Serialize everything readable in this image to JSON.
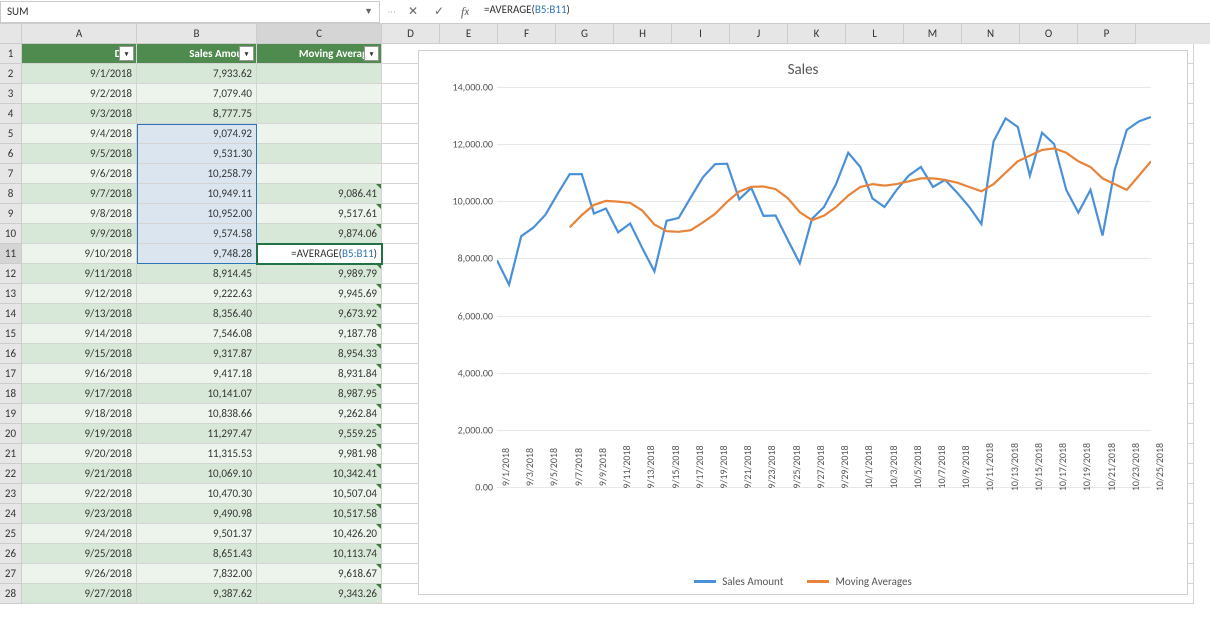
{
  "nameBox": "SUM",
  "formula": {
    "prefix": "=AVERAGE(",
    "ref": "B5:B11",
    "suffix": ")"
  },
  "columns": [
    "A",
    "B",
    "C",
    "D",
    "E",
    "F",
    "G",
    "H",
    "I",
    "J",
    "K",
    "L",
    "M",
    "N",
    "O",
    "P"
  ],
  "headers": {
    "a": "Day",
    "b": "Sales Amount",
    "c": "Moving Averages"
  },
  "rows": [
    {
      "n": 1
    },
    {
      "n": 2,
      "a": "9/1/2018",
      "b": "7,933.62",
      "c": ""
    },
    {
      "n": 3,
      "a": "9/2/2018",
      "b": "7,079.40",
      "c": ""
    },
    {
      "n": 4,
      "a": "9/3/2018",
      "b": "8,777.75",
      "c": ""
    },
    {
      "n": 5,
      "a": "9/4/2018",
      "b": "9,074.92",
      "c": ""
    },
    {
      "n": 6,
      "a": "9/5/2018",
      "b": "9,531.30",
      "c": ""
    },
    {
      "n": 7,
      "a": "9/6/2018",
      "b": "10,258.79",
      "c": ""
    },
    {
      "n": 8,
      "a": "9/7/2018",
      "b": "10,949.11",
      "c": "9,086.41"
    },
    {
      "n": 9,
      "a": "9/8/2018",
      "b": "10,952.00",
      "c": "9,517.61"
    },
    {
      "n": 10,
      "a": "9/9/2018",
      "b": "9,574.58",
      "c": "9,874.06"
    },
    {
      "n": 11,
      "a": "9/10/2018",
      "b": "9,748.28",
      "c": "=AVERAGE(B5:B11)"
    },
    {
      "n": 12,
      "a": "9/11/2018",
      "b": "8,914.45",
      "c": "9,989.79"
    },
    {
      "n": 13,
      "a": "9/12/2018",
      "b": "9,222.63",
      "c": "9,945.69"
    },
    {
      "n": 14,
      "a": "9/13/2018",
      "b": "8,356.40",
      "c": "9,673.92"
    },
    {
      "n": 15,
      "a": "9/14/2018",
      "b": "7,546.08",
      "c": "9,187.78"
    },
    {
      "n": 16,
      "a": "9/15/2018",
      "b": "9,317.87",
      "c": "8,954.33"
    },
    {
      "n": 17,
      "a": "9/16/2018",
      "b": "9,417.18",
      "c": "8,931.84"
    },
    {
      "n": 18,
      "a": "9/17/2018",
      "b": "10,141.07",
      "c": "8,987.95"
    },
    {
      "n": 19,
      "a": "9/18/2018",
      "b": "10,838.66",
      "c": "9,262.84"
    },
    {
      "n": 20,
      "a": "9/19/2018",
      "b": "11,297.47",
      "c": "9,559.25"
    },
    {
      "n": 21,
      "a": "9/20/2018",
      "b": "11,315.53",
      "c": "9,981.98"
    },
    {
      "n": 22,
      "a": "9/21/2018",
      "b": "10,069.10",
      "c": "10,342.41"
    },
    {
      "n": 23,
      "a": "9/22/2018",
      "b": "10,470.30",
      "c": "10,507.04"
    },
    {
      "n": 24,
      "a": "9/23/2018",
      "b": "9,490.98",
      "c": "10,517.58"
    },
    {
      "n": 25,
      "a": "9/24/2018",
      "b": "9,501.37",
      "c": "10,426.20"
    },
    {
      "n": 26,
      "a": "9/25/2018",
      "b": "8,651.43",
      "c": "10,113.74"
    },
    {
      "n": 27,
      "a": "9/26/2018",
      "b": "7,832.00",
      "c": "9,618.67"
    },
    {
      "n": 28,
      "a": "9/27/2018",
      "b": "9,387.62",
      "c": "9,343.26"
    }
  ],
  "chart_data": {
    "type": "line",
    "title": "Sales",
    "ylim": [
      0,
      14000
    ],
    "yticks": [
      "0.00",
      "2,000.00",
      "4,000.00",
      "6,000.00",
      "8,000.00",
      "10,000.00",
      "12,000.00",
      "14,000.00"
    ],
    "xticks": [
      "9/1/2018",
      "9/3/2018",
      "9/5/2018",
      "9/7/2018",
      "9/9/2018",
      "9/11/2018",
      "9/13/2018",
      "9/15/2018",
      "9/17/2018",
      "9/19/2018",
      "9/21/2018",
      "9/23/2018",
      "9/25/2018",
      "9/27/2018",
      "9/29/2018",
      "10/1/2018",
      "10/3/2018",
      "10/5/2018",
      "10/7/2018",
      "10/9/2018",
      "10/11/2018",
      "10/13/2018",
      "10/15/2018",
      "10/17/2018",
      "10/19/2018",
      "10/21/2018",
      "10/23/2018",
      "10/25/2018"
    ],
    "series": [
      {
        "name": "Sales Amount",
        "color": "#4a90d9",
        "values": [
          7933,
          7079,
          8777,
          9074,
          9531,
          10258,
          10949,
          10952,
          9574,
          9748,
          8914,
          9222,
          8356,
          7546,
          9317,
          9417,
          10141,
          10838,
          11297,
          11315,
          10069,
          10470,
          9490,
          9501,
          8651,
          7832,
          9387,
          9800,
          10600,
          11700,
          11200,
          10100,
          9800,
          10400,
          10900,
          11200,
          10500,
          10750,
          10300,
          9800,
          9200,
          12100,
          12900,
          12600,
          10900,
          12400,
          12000,
          10400,
          9600,
          10400,
          8800,
          11100,
          12500,
          12800,
          12950
        ]
      },
      {
        "name": "Moving Averages",
        "color": "#e8833a",
        "values": [
          null,
          null,
          null,
          null,
          null,
          null,
          9086,
          9517,
          9874,
          10012,
          9989,
          9945,
          9673,
          9187,
          8954,
          8931,
          8987,
          9262,
          9559,
          9981,
          10342,
          10507,
          10517,
          10426,
          10113,
          9618,
          9343,
          9500,
          9800,
          10200,
          10500,
          10600,
          10550,
          10600,
          10700,
          10800,
          10800,
          10750,
          10650,
          10500,
          10350,
          10600,
          11000,
          11400,
          11600,
          11800,
          11850,
          11700,
          11400,
          11200,
          10800,
          10600,
          10400,
          10900,
          11400
        ]
      }
    ],
    "legend": [
      "Sales Amount",
      "Moving Averages"
    ]
  }
}
